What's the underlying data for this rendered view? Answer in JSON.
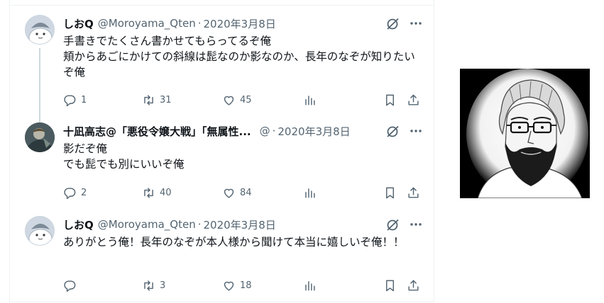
{
  "tweets": [
    {
      "name": "しおQ",
      "handle": "@Moroyama_Qten",
      "sep": "·",
      "date": "2020年3月8日",
      "text": "手書きでたくさん書かせてもらってるぞ俺\n頬からあごにかけての斜線は髭なのか影なのか、長年のなぞが知りたいぞ俺",
      "replies": "1",
      "retweets": "31",
      "likes": "45"
    },
    {
      "name": "十凪高志@「悪役令嬢大戦」「無属性...",
      "handle": "@",
      "sep": "·",
      "date": "2020年3月8日",
      "text": "影だぞ俺\nでも髭でも別にいいぞ俺",
      "replies": "2",
      "retweets": "40",
      "likes": "84"
    },
    {
      "name": "しおQ",
      "handle": "@Moroyama_Qten",
      "sep": "·",
      "date": "2020年3月8日",
      "text": "ありがとう俺！長年のなぞが本人様から聞けて本当に嬉しいぞ俺！！",
      "replies": "",
      "retweets": "3",
      "likes": "18"
    }
  ],
  "icons": {
    "grok": "grok-icon",
    "more": "more-icon",
    "reply": "reply-icon",
    "retweet": "retweet-icon",
    "like": "like-icon",
    "views": "views-icon",
    "bookmark": "bookmark-icon",
    "share": "share-icon"
  },
  "colors": {
    "text": "#0f1419",
    "secondary": "#536471",
    "divider": "#eff3f4",
    "thread_line": "#cfd9de"
  }
}
